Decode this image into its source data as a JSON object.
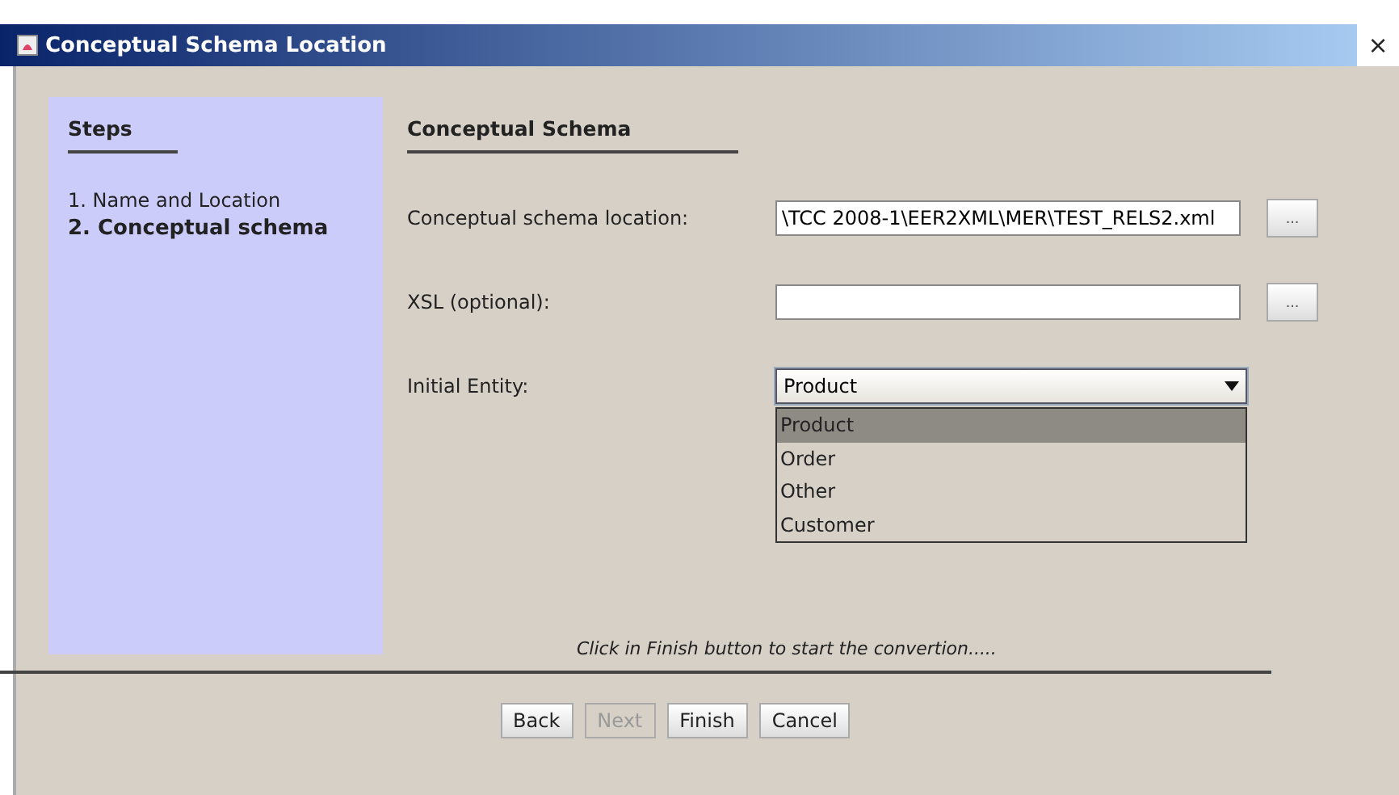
{
  "window": {
    "title": "Conceptual Schema Location",
    "close": "×"
  },
  "steps": {
    "title": "Steps",
    "items": [
      {
        "label": "1. Name and Location",
        "selected": false
      },
      {
        "label": "2. Conceptual schema",
        "selected": true
      }
    ]
  },
  "panel": {
    "title": "Conceptual Schema",
    "fields": [
      {
        "kind": "text",
        "label": "Conceptual schema location:",
        "value": "\\TCC 2008-1\\EER2XML\\MER\\TEST_RELS2.xml",
        "browse": "..."
      },
      {
        "kind": "text",
        "label": "XSL (optional):",
        "browse": "..."
      },
      {
        "kind": "combo",
        "label": "Initial Entity:",
        "value": "Product",
        "expanded": true,
        "options": [
          {
            "label": "Product",
            "selected": true
          },
          {
            "label": "Order",
            "selected": false
          },
          {
            "label": "Other",
            "selected": false
          },
          {
            "label": "Customer",
            "selected": false
          }
        ]
      }
    ],
    "hint": "Click in Finish button to start the convertion....."
  },
  "buttons": [
    {
      "label": "Back",
      "disabled": false
    },
    {
      "label": "Next",
      "disabled": true
    },
    {
      "label": "Finish",
      "disabled": false
    },
    {
      "label": "Cancel",
      "disabled": false
    }
  ]
}
